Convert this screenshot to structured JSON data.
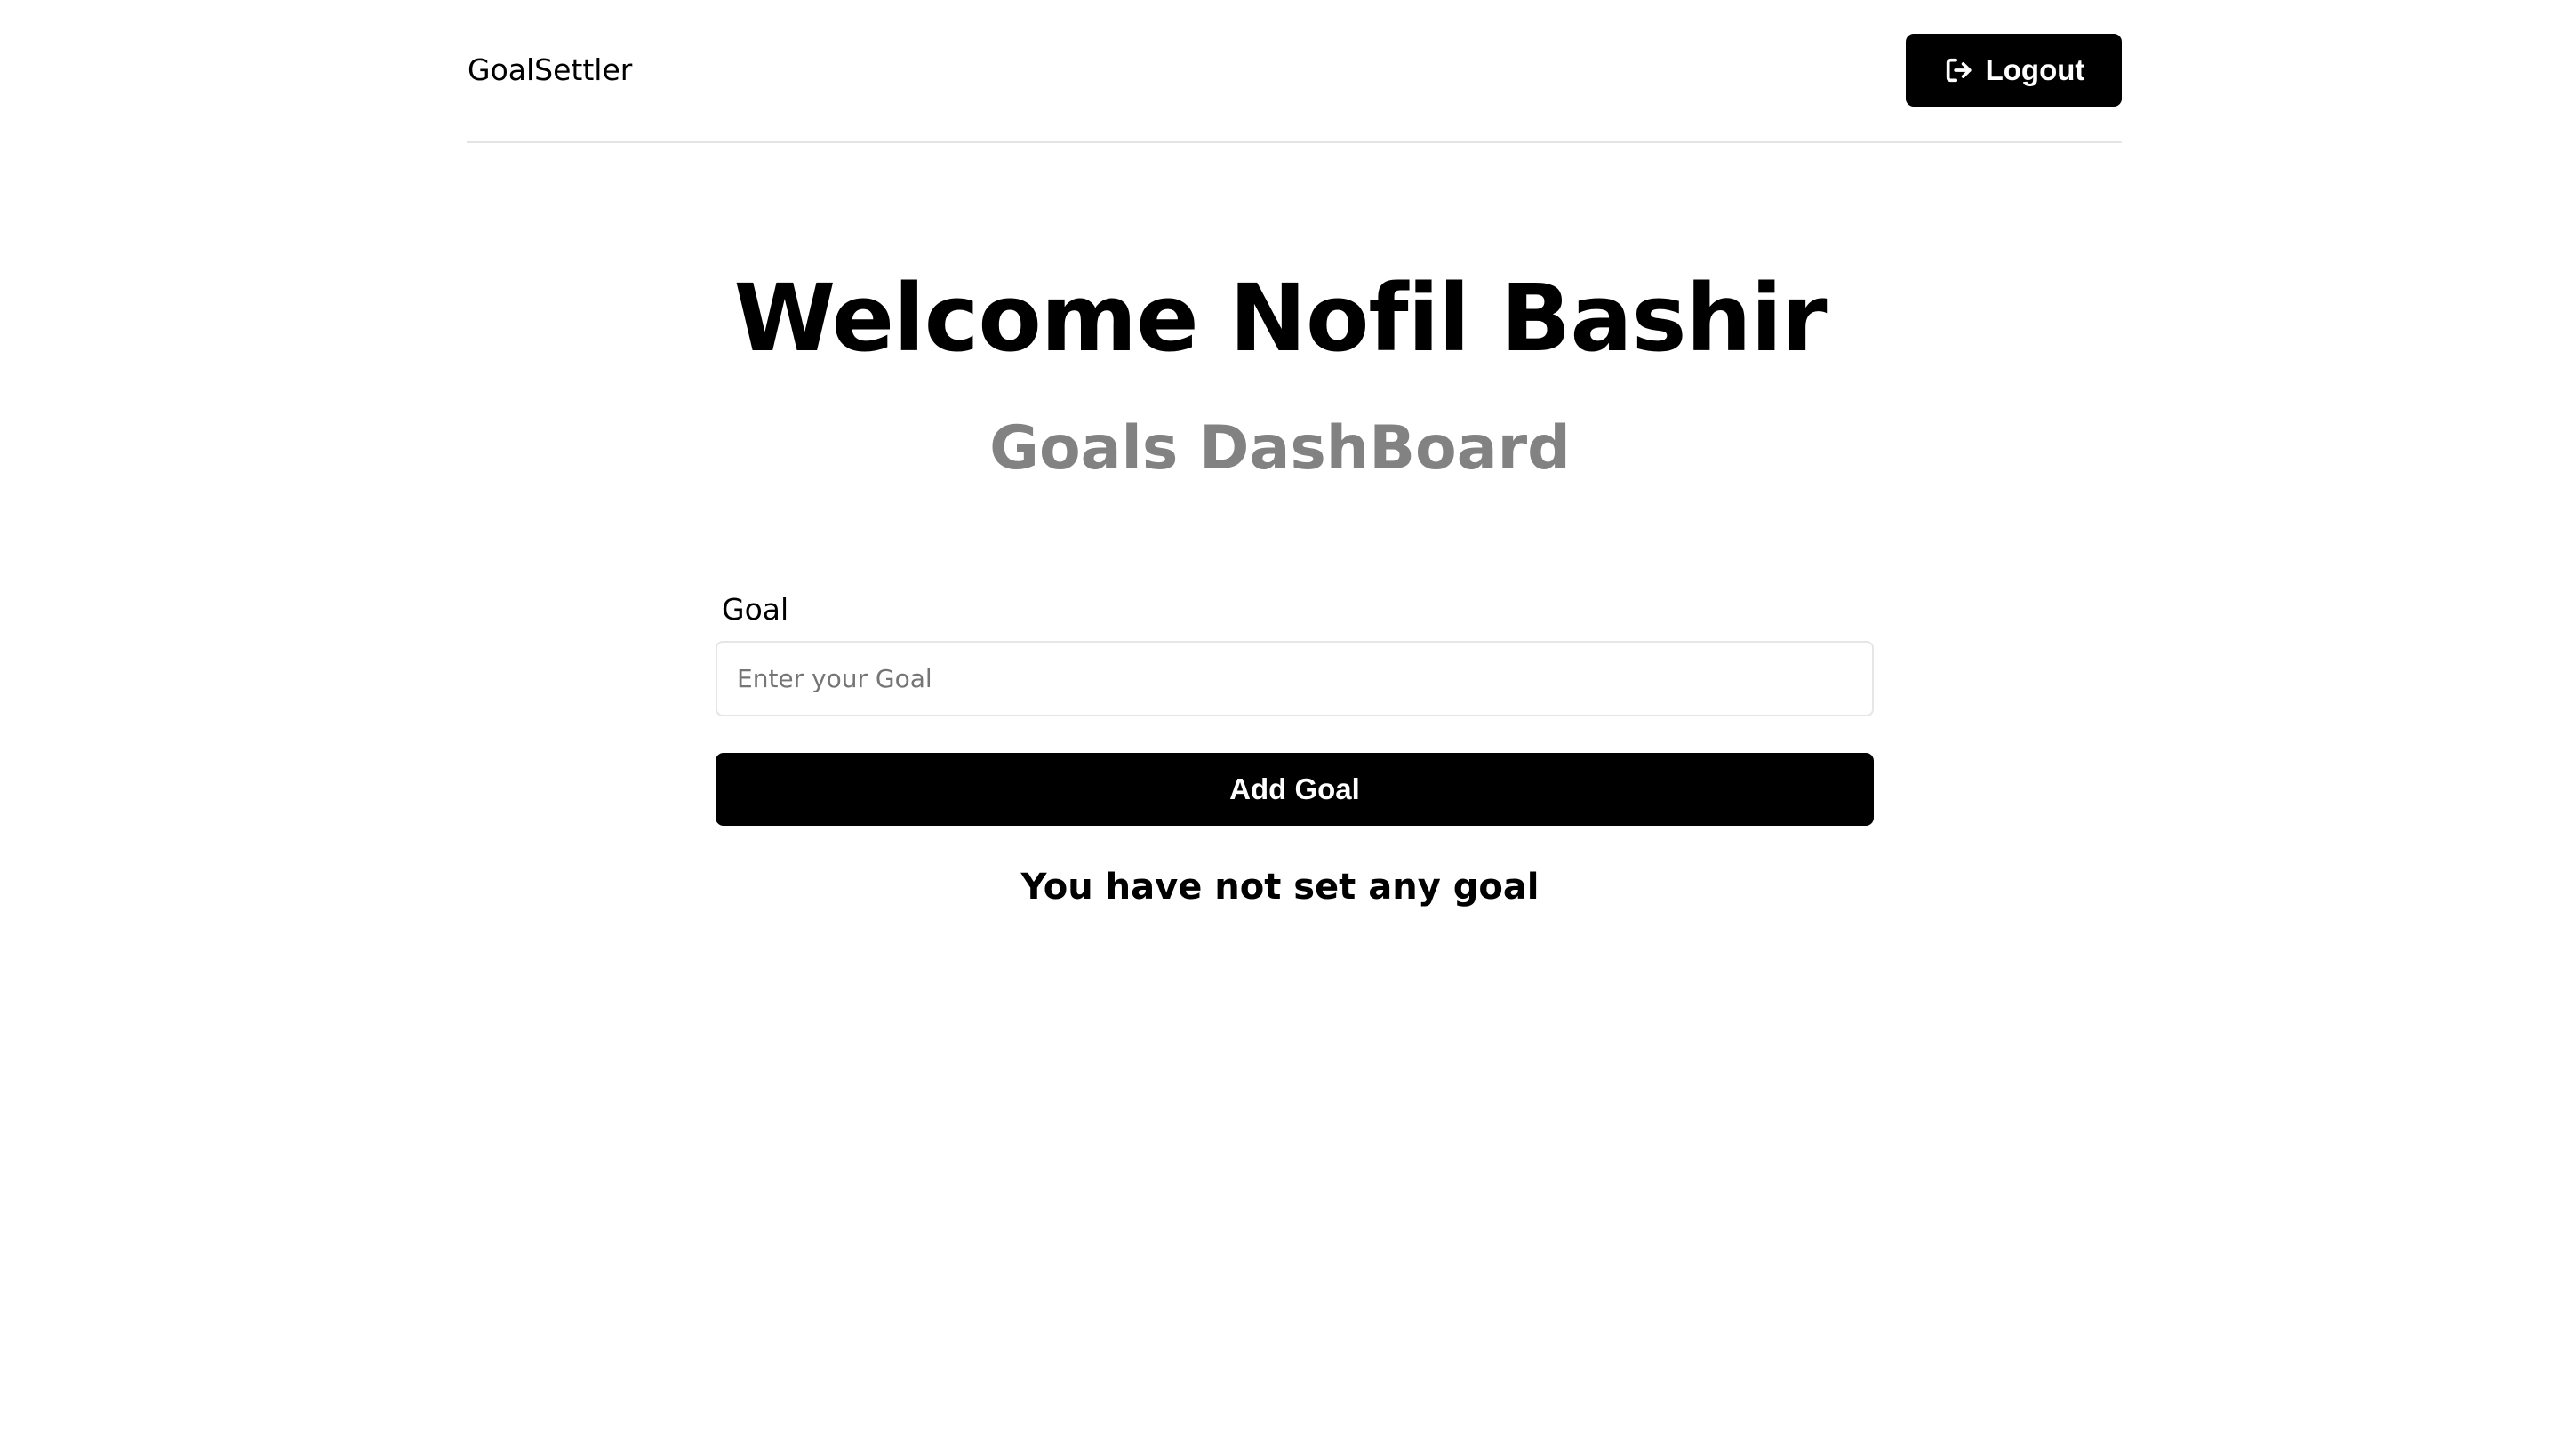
{
  "header": {
    "brand": "GoalSettler",
    "logout_label": "Logout",
    "logout_icon": "sign-out-icon"
  },
  "main": {
    "welcome": "Welcome Nofil Bashir",
    "subtitle": "Goals DashBoard"
  },
  "goal_form": {
    "label": "Goal",
    "input_value": "",
    "placeholder": "Enter your Goal",
    "submit_label": "Add Goal"
  },
  "goals": {
    "empty_message": "You have not set any goal"
  },
  "colors": {
    "background": "#ffffff",
    "primary": "#000000",
    "subtitle": "#828282",
    "divider": "#e4e4e4",
    "input_border": "#e6e6e6"
  }
}
